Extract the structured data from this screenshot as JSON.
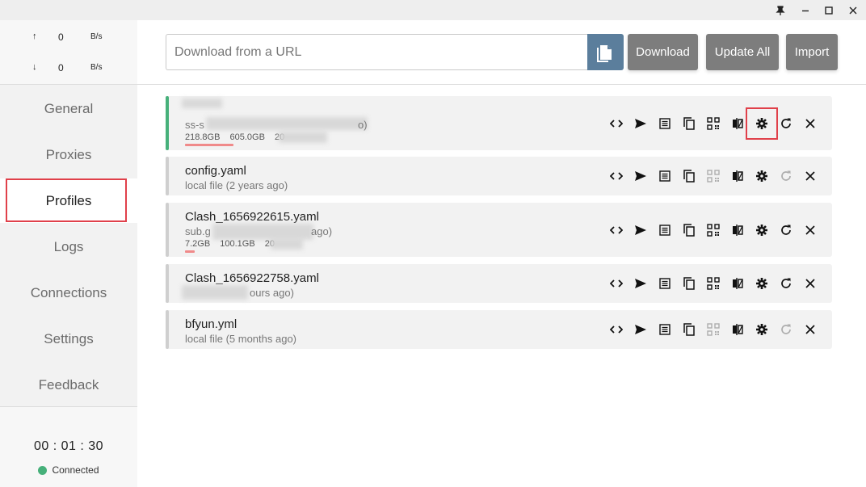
{
  "traffic": {
    "up": {
      "arrow": "↑",
      "value": "0",
      "unit": "B/s"
    },
    "down": {
      "arrow": "↓",
      "value": "0",
      "unit": "B/s"
    }
  },
  "nav": [
    {
      "label": "General"
    },
    {
      "label": "Proxies"
    },
    {
      "label": "Profiles",
      "active": true
    },
    {
      "label": "Logs"
    },
    {
      "label": "Connections"
    },
    {
      "label": "Settings"
    },
    {
      "label": "Feedback"
    }
  ],
  "status": {
    "uptime": "00 : 01 : 30",
    "connection": "Connected",
    "connection_color": "#46b07a"
  },
  "header": {
    "url_placeholder": "Download from a URL",
    "download_label": "Download",
    "update_all_label": "Update All",
    "import_label": "Import"
  },
  "profiles": [
    {
      "name": "",
      "sub": "ss-s",
      "sub_tail": "o)",
      "usage": [
        "218.8GB",
        "605.0GB",
        "20"
      ],
      "usage_fraction": 0.36,
      "selected": true
    },
    {
      "name": "config.yaml",
      "sub": "local file (2 years ago)",
      "usage": [],
      "selected": false
    },
    {
      "name": "Clash_1656922615.yaml",
      "sub": "sub.g",
      "sub_tail": "ago)",
      "usage": [
        "7.2GB",
        "100.1GB",
        "20"
      ],
      "usage_fraction": 0.07,
      "selected": false
    },
    {
      "name": "Clash_1656922758.yaml",
      "sub": "ours ago)",
      "usage": [],
      "selected": false
    },
    {
      "name": "bfyun.yml",
      "sub": "local file (5 months ago)",
      "usage": [],
      "selected": false
    }
  ],
  "icons": {
    "action_order": [
      "code-icon",
      "send-icon",
      "list-icon",
      "copy-icon",
      "qrcode-icon",
      "compare-icon",
      "gear-icon",
      "refresh-icon",
      "close-icon"
    ],
    "titlebar": [
      "pin-icon",
      "minimize-icon",
      "maximize-icon",
      "close-icon"
    ]
  },
  "colors": {
    "accent": "#5b7e9c",
    "highlight": "#e0404a",
    "selected_bar": "#46b07a",
    "button": "#7d7d7d"
  }
}
